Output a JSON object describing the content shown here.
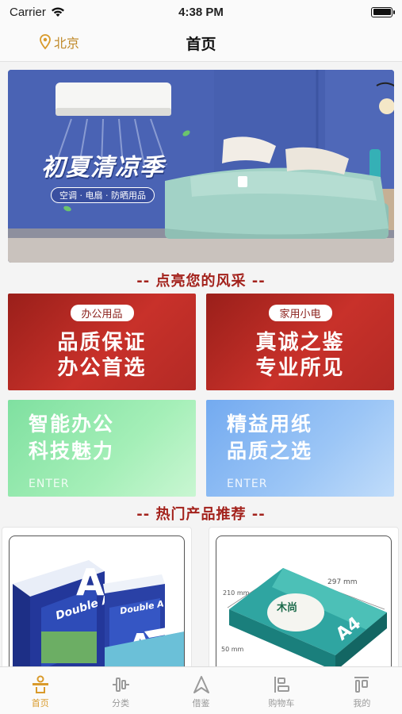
{
  "status_bar": {
    "carrier": "Carrier",
    "time": "4:38 PM"
  },
  "nav": {
    "location": "北京",
    "title": "首页"
  },
  "banner": {
    "title": "初夏清凉季",
    "subtitle": "空调 · 电扇 · 防晒用品"
  },
  "sections": {
    "highlight": "-- 点亮您的风采 --",
    "hot": "-- 热门产品推荐 --"
  },
  "cards": {
    "office": {
      "tag": "办公用品",
      "line1": "品质保证",
      "line2": "办公首选"
    },
    "appliance": {
      "tag": "家用小电",
      "line1": "真诚之鉴",
      "line2": "专业所见"
    },
    "smart": {
      "line1": "智能办公",
      "line2": "科技魅力",
      "enter": "ENTER"
    },
    "paper": {
      "line1": "精益用纸",
      "line2": "品质之选",
      "enter": "ENTER"
    }
  },
  "products": [
    {
      "brand": "Double A",
      "box_letter": "A"
    },
    {
      "brand": "木尚",
      "size": "A4",
      "dim_w": "297 mm",
      "dim_h": "210 mm",
      "dim_d": "50 mm"
    }
  ],
  "tabs": [
    {
      "label": "首页",
      "icon": "home-icon",
      "active": true
    },
    {
      "label": "分类",
      "icon": "category-icon",
      "active": false
    },
    {
      "label": "借鉴",
      "icon": "reference-icon",
      "active": false
    },
    {
      "label": "购物车",
      "icon": "cart-icon",
      "active": false
    },
    {
      "label": "我的",
      "icon": "profile-icon",
      "active": false
    }
  ],
  "colors": {
    "accent": "#d99a2b",
    "section_title": "#a3221c",
    "inactive_tab": "#9a9a9a"
  }
}
